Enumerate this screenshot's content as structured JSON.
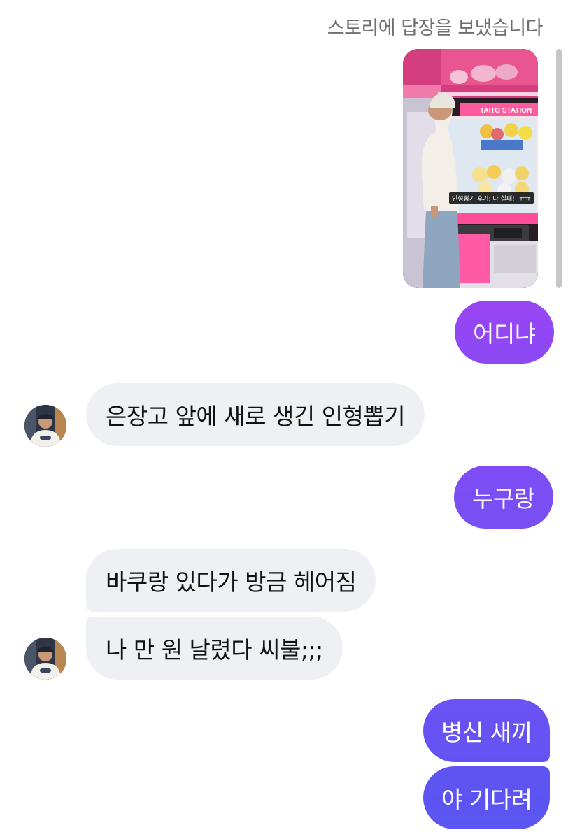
{
  "story_reply": {
    "caption": "스토리에 답장을 보냈습니다",
    "overlay_text": "인형뽑기 후기: 다 실패!! ㅠㅠ",
    "sign_text": "TAITO STATION"
  },
  "colors": {
    "sent_bubble_top": "#9b45f4",
    "sent_bubble_bottom": "#5b55f2",
    "received_bubble": "#eff0f3",
    "caption_text": "#6f6f6f"
  },
  "messages": [
    {
      "direction": "sent",
      "text": "어디냐"
    },
    {
      "direction": "received",
      "text": "은장고 앞에 새로 생긴 인형뽑기"
    },
    {
      "direction": "sent",
      "text": "누구랑"
    },
    {
      "direction": "received",
      "text": "바쿠랑 있다가 방금 헤어짐"
    },
    {
      "direction": "received",
      "text": "나 만 원 날렸다 씨불;;;"
    },
    {
      "direction": "sent",
      "text": "병신 새끼"
    },
    {
      "direction": "sent",
      "text": "야 기다려"
    }
  ]
}
